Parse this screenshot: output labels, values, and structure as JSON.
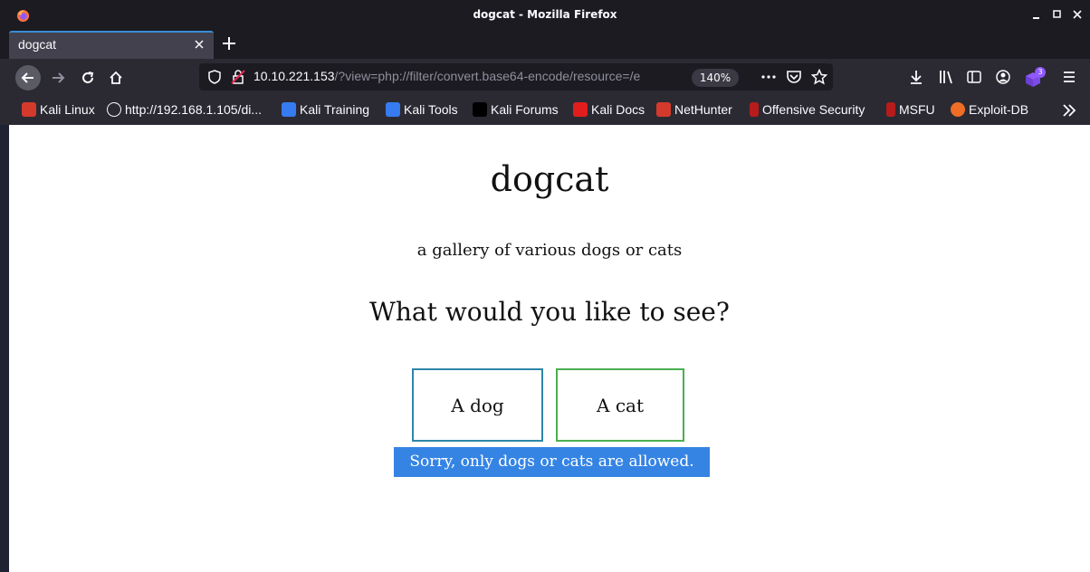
{
  "window": {
    "title": "dogcat - Mozilla Firefox"
  },
  "tabs": [
    {
      "label": "dogcat",
      "active": true
    }
  ],
  "urlbar": {
    "host": "10.10.221.153",
    "path": "/?view=php://filter/convert.base64-encode/resource=/e",
    "zoom": "140%"
  },
  "toolbar": {
    "extension_badge": "3"
  },
  "bookmarks": [
    {
      "label": "Kali Linux",
      "icon": "kali-dragon-icon"
    },
    {
      "label": "http://192.168.1.105/di...",
      "icon": "globe-icon"
    },
    {
      "label": "Kali Training",
      "icon": "kali-training-icon"
    },
    {
      "label": "Kali Tools",
      "icon": "kali-tools-icon"
    },
    {
      "label": "Kali Forums",
      "icon": "kali-forums-icon"
    },
    {
      "label": "Kali Docs",
      "icon": "kali-docs-icon"
    },
    {
      "label": "NetHunter",
      "icon": "nethunter-icon"
    },
    {
      "label": "Offensive Security",
      "icon": "offsec-icon"
    },
    {
      "label": "MSFU",
      "icon": "msfu-icon"
    },
    {
      "label": "Exploit-DB",
      "icon": "exploit-db-icon"
    }
  ],
  "page": {
    "title": "dogcat",
    "subtitle": "a gallery of various dogs or cats",
    "question": "What would you like to see?",
    "buttons": [
      {
        "label": "A dog",
        "color": "#2e86a8"
      },
      {
        "label": "A cat",
        "color": "#4caf50"
      }
    ],
    "error": "Sorry, only dogs or cats are allowed."
  },
  "colors": {
    "chrome_dark": "#1c1b22",
    "toolbar": "#2b2a33",
    "tab_active": "#42414d",
    "accent": "#3b8dd8",
    "selection": "#3584e4"
  }
}
